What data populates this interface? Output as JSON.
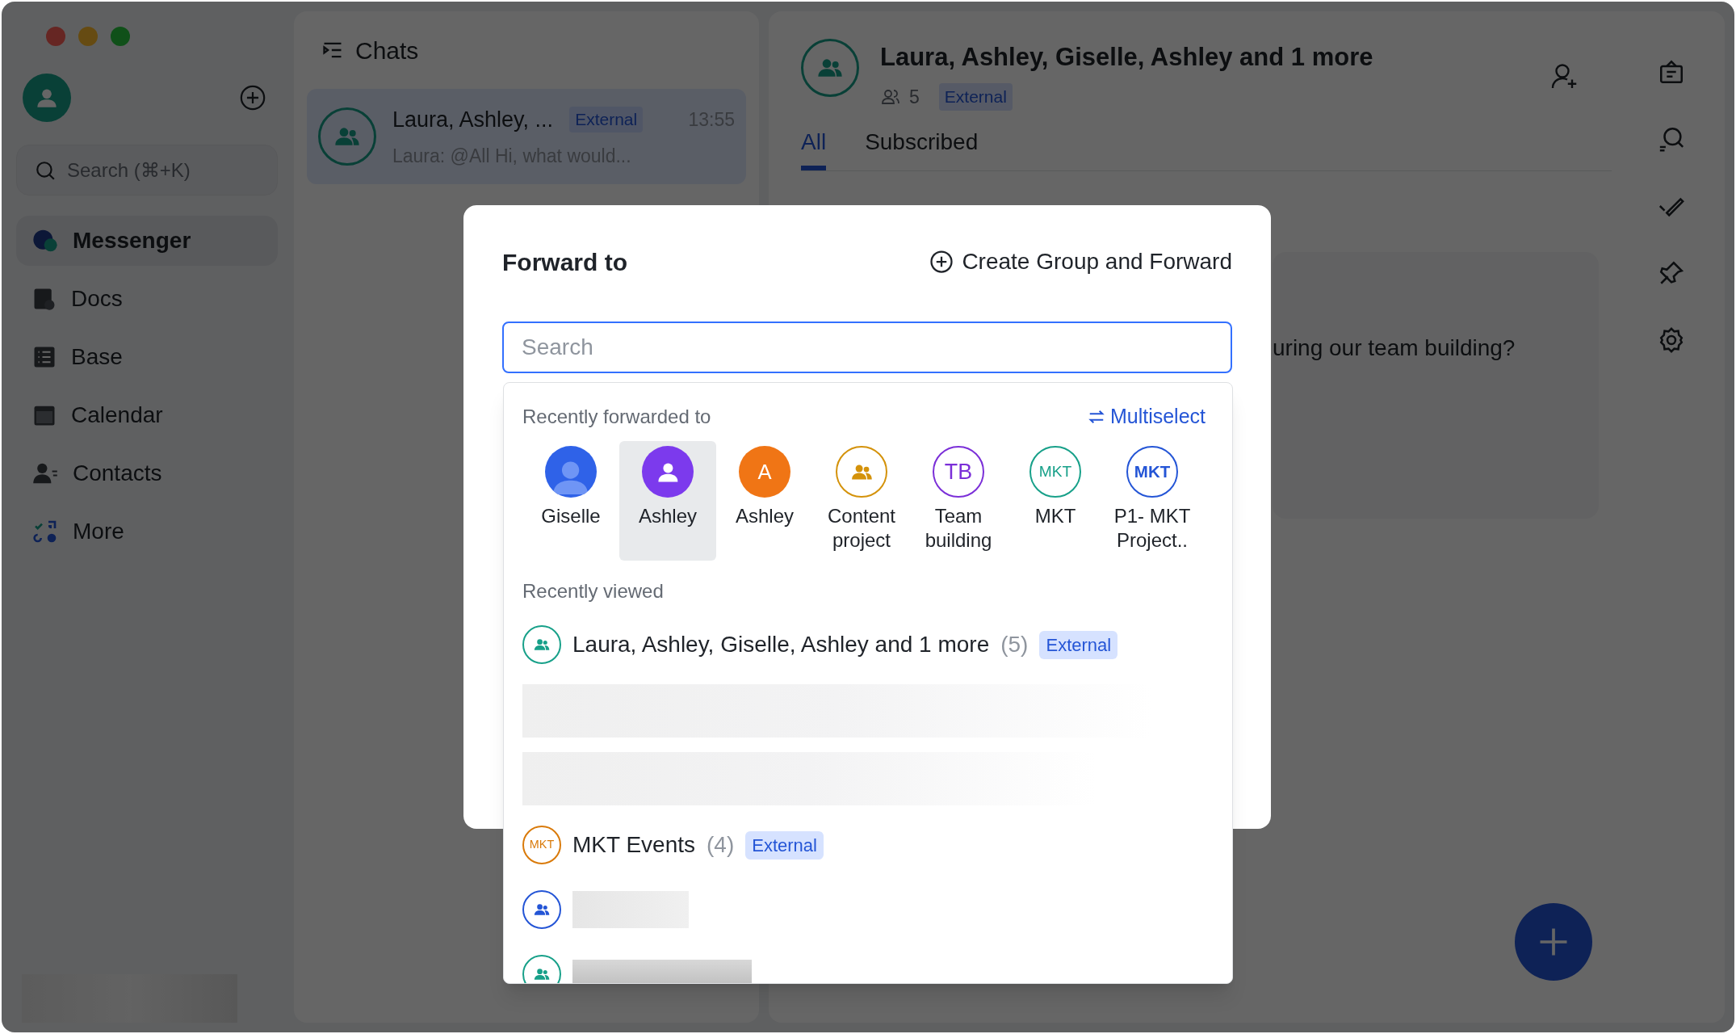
{
  "sidebar": {
    "search": {
      "placeholder": "Search (⌘+K)"
    },
    "nav": [
      {
        "label": "Messenger",
        "selected": true
      },
      {
        "label": "Docs",
        "selected": false
      },
      {
        "label": "Base",
        "selected": false
      },
      {
        "label": "Calendar",
        "selected": false
      },
      {
        "label": "Contacts",
        "selected": false
      },
      {
        "label": "More",
        "selected": false
      }
    ]
  },
  "chats": {
    "title": "Chats",
    "items": [
      {
        "title": "Laura, Ashley, ...",
        "tag": "External",
        "time": "13:55",
        "preview": "Laura: @All Hi, what would...",
        "selected": true
      }
    ]
  },
  "conversation": {
    "title": "Laura, Ashley, Giselle, Ashley and 1 more",
    "member_count": "5",
    "tag": "External",
    "tabs": [
      {
        "label": "All",
        "selected": true
      },
      {
        "label": "Subscribed",
        "selected": false
      }
    ],
    "message": "uring our team building?"
  },
  "dialog": {
    "title": "Forward to",
    "create_button": "Create Group and Forward",
    "search": {
      "placeholder": "Search"
    },
    "recent_label": "Recently forwarded to",
    "multiselect": "Multiselect",
    "recent": [
      {
        "label": "Giselle",
        "kind": "photo",
        "color": "#2f62e8",
        "selected": false
      },
      {
        "label": "Ashley",
        "kind": "person",
        "color": "#7c3aed",
        "selected": true
      },
      {
        "label": "Ashley",
        "kind": "letter",
        "text": "A",
        "color": "#f07515",
        "selected": false
      },
      {
        "label": "Content project",
        "kind": "group",
        "color": "#d4920a",
        "selected": false
      },
      {
        "label": "Team building",
        "kind": "initials",
        "text": "TB",
        "color": "#7b2fd8",
        "selected": false
      },
      {
        "label": "MKT",
        "kind": "initials",
        "text": "MKT",
        "color": "#17a089",
        "selected": false
      },
      {
        "label": "P1- MKT Project..",
        "kind": "initials_bold",
        "text": "MKT",
        "color": "#2455d6",
        "selected": false
      }
    ],
    "viewed_label": "Recently viewed",
    "viewed": [
      {
        "kind": "chat",
        "avatar": {
          "kind": "group",
          "color": "#17a089"
        },
        "name": "Laura, Ashley, Giselle, Ashley and 1 more",
        "count": "(5)",
        "tag": "External"
      },
      {
        "kind": "blurred"
      },
      {
        "kind": "blurred"
      },
      {
        "kind": "chat",
        "avatar": {
          "kind": "initials",
          "text": "MKT",
          "color": "#d97a0a"
        },
        "name": "MKT Events",
        "count": "(4)",
        "tag": "External"
      },
      {
        "kind": "hidden",
        "avatar": {
          "kind": "group",
          "color": "#2455d6"
        }
      },
      {
        "kind": "hidden",
        "avatar": {
          "kind": "group",
          "color": "#17a089"
        }
      }
    ]
  }
}
